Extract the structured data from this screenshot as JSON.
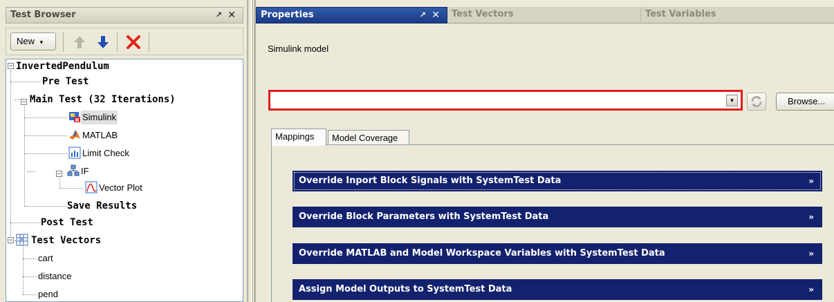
{
  "left_pane": {
    "title": "Test Browser",
    "pin_glyph": "↗",
    "close_glyph": "✕",
    "toolbar": {
      "new_label": "New",
      "new_caret": "▾",
      "icons": [
        "move-up-icon",
        "move-down-icon",
        "delete-icon"
      ]
    },
    "tree": {
      "root": "InvertedPendulum",
      "pre_test": "Pre Test",
      "main_test": "Main Test (32 Iterations)",
      "simulink": "Simulink",
      "matlab": "MATLAB",
      "limit_check": "Limit Check",
      "if": "IF",
      "vector_plot": "Vector Plot",
      "save_results": "Save Results",
      "post_test": "Post Test",
      "test_vectors": "Test Vectors",
      "cart": "cart",
      "distance": "distance",
      "pend": "pend",
      "expand_minus": "−"
    }
  },
  "right_pane": {
    "tabs": {
      "properties": "Properties",
      "test_vectors": "Test Vectors",
      "test_variables": "Test Variables",
      "pin_glyph": "↗",
      "close_glyph": "✕"
    },
    "simulink_label": "Simulink model",
    "model_value": "",
    "combo_arrow": "▼",
    "browse_label": "Browse...",
    "inner_tabs": {
      "mappings": "Mappings",
      "model_coverage": "Model Coverage"
    },
    "sections": [
      "Override Inport Block Signals with SystemTest Data",
      "Override Block Parameters with SystemTest Data",
      "Override MATLAB and Model Workspace Variables with SystemTest Data",
      "Assign Model Outputs to SystemTest Data"
    ],
    "section_chevron": "»"
  },
  "colors": {
    "active_tab": "#1c3b86",
    "section_bar": "#13226e",
    "error_border": "#e21c1c",
    "panel_bg": "#ece9d8"
  }
}
